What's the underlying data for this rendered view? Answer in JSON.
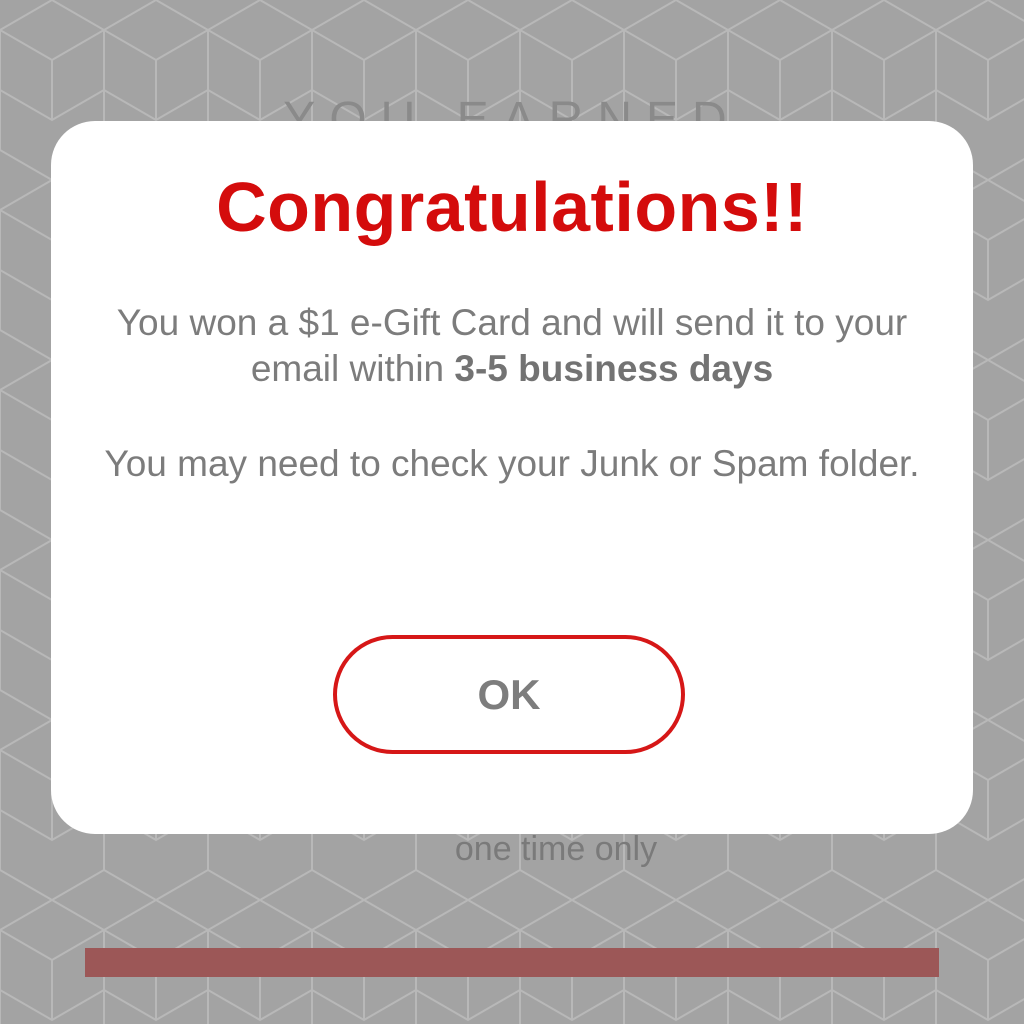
{
  "background": {
    "heading": "YOU EARNED",
    "note": "one time only",
    "bar_color": "#9c5757",
    "pattern": "hexagon-cube-pattern"
  },
  "dialog": {
    "title": "Congratulations!!",
    "message_line1_prefix": "You won a $1 e-Gift Card and will send it to your email within ",
    "message_line1_bold": "3-5 business days",
    "message_line2": "You may need to check your Junk or Spam folder.",
    "ok_label": "OK",
    "title_color": "#d40c0c",
    "button_border_color": "#d61717"
  }
}
